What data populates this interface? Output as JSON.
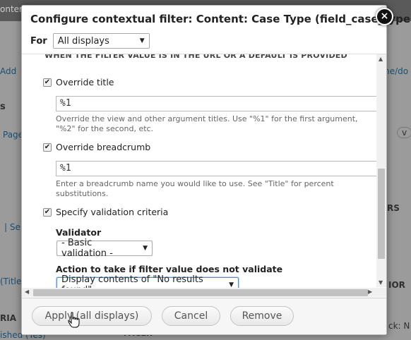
{
  "background": {
    "top_left_fragment": "ontent",
    "add_link": "Add",
    "letter_s": "s",
    "page_fragment": "Page",
    "pipe_fragment": "|  Se",
    "title_fragment": "(Title",
    "ria_fragment": "RIA",
    "published_fragment": "ished (Yes)",
    "path_fragment": "me/do",
    "v_fragment": "v",
    "rs_fragment": "RS",
    "ior_fragment": "IOR",
    "ck_fragment": "ck:  N",
    "pager_fragment": "PAGER"
  },
  "dialog": {
    "title": "Configure contextual filter: Content: Case Type (field_case_type)",
    "close_glyph": "×",
    "for_label": "For",
    "for_select_value": "All displays",
    "truncated_heading": "WHEN THE FILTER VALUE IS IN THE URL OR A DEFAULT IS PROVIDED",
    "override_title": {
      "label": "Override title",
      "checked": true,
      "value": "%1",
      "description": "Override the view and other argument titles. Use \"%1\" for the first argument, \"%2\" for the second, etc."
    },
    "override_breadcrumb": {
      "label": "Override breadcrumb",
      "checked": true,
      "value": "%1",
      "description": "Enter a breadcrumb name you would like to use. See \"Title\" for percent substitutions."
    },
    "validation": {
      "label": "Specify validation criteria",
      "checked": true,
      "validator_label": "Validator",
      "validator_value": "- Basic validation -",
      "action_label": "Action to take if filter value does not validate",
      "action_value": "Display contents of \"No results found\""
    },
    "buttons": {
      "apply": "Apply (all displays)",
      "cancel": "Cancel",
      "remove": "Remove"
    }
  },
  "icons": {
    "check": "✔",
    "select_arrow": "▼",
    "scroll_up": "▲",
    "scroll_down": "▼",
    "scroll_left": "◀",
    "scroll_right": "▶"
  }
}
